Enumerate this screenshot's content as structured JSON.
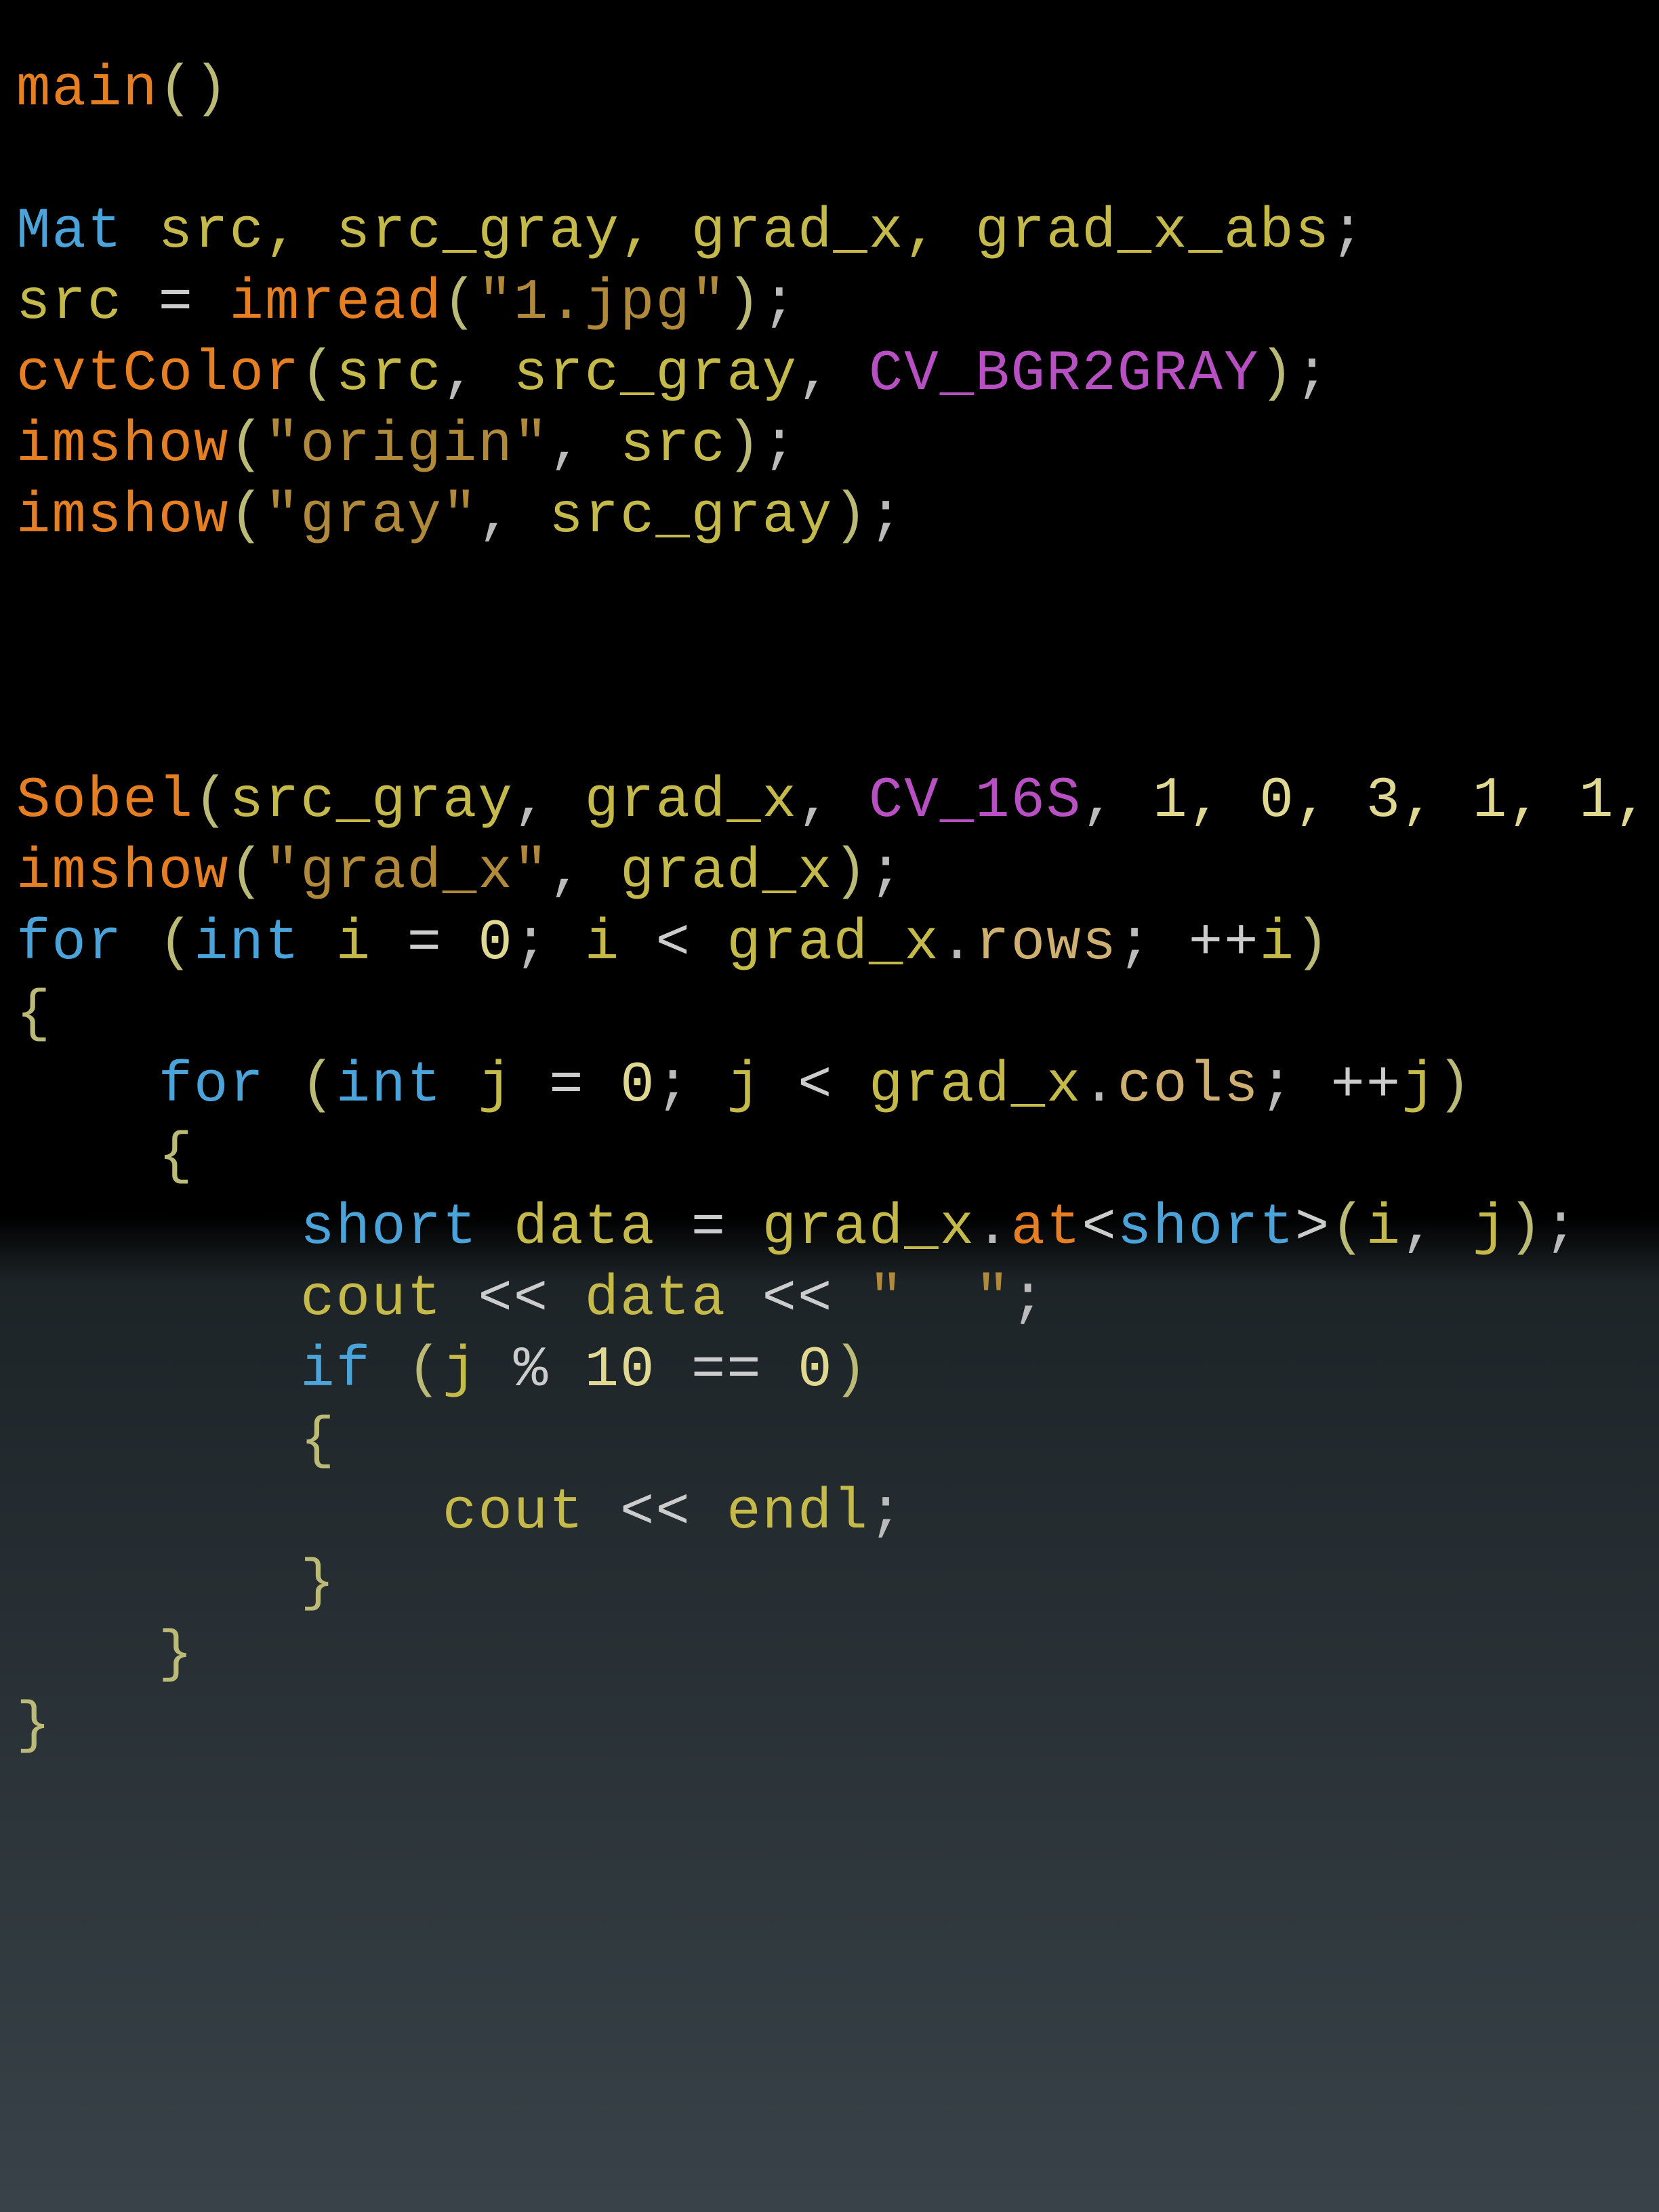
{
  "syntax": {
    "main": "main",
    "mat": "Mat",
    "vars_decl": "src, src_gray, grad_x, grad_x_abs",
    "src": "src",
    "src_gray": "src_gray",
    "grad_x": "grad_x",
    "imread": "imread",
    "file_str": "\"1.jpg\"",
    "cvtColor": "cvtColor",
    "cv_bgr2gray": "CV_BGR2GRAY",
    "imshow": "imshow",
    "origin_str": "\"origin\"",
    "gray_str": "\"gray\"",
    "grad_x_str": "\"grad_x\"",
    "sobel": "Sobel",
    "cv_16s": "CV_16S",
    "sobel_args_tail": "1, 0, 3, 1, 1,",
    "for_kw": "for",
    "int_kw": "int",
    "short_kw": "short",
    "if_kw": "if",
    "i": "i",
    "j": "j",
    "zero": "0",
    "ten": "10",
    "rows": "rows",
    "cols": "cols",
    "data": "data",
    "at": "at",
    "cout": "cout",
    "endl": "endl",
    "space_str": "\"  \"",
    "lt": "<",
    "gt": ">",
    "eq": "=",
    "eqeq": "==",
    "mod": "%",
    "inc": "++",
    "ins": "<<",
    "dot": ".",
    "comma": ",",
    "semi": ";",
    "lparen": "(",
    "rparen": ")",
    "lbrace": "{",
    "rbrace": "}"
  }
}
